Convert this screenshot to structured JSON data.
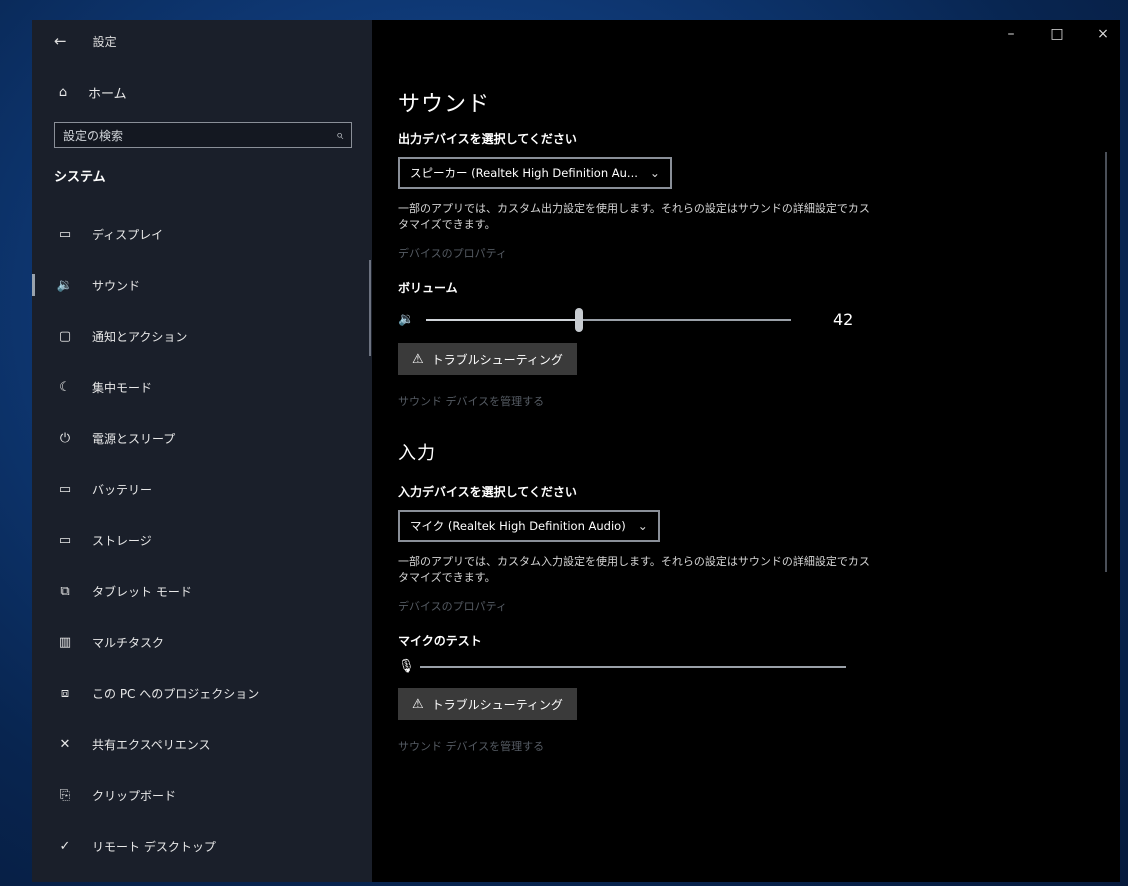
{
  "window": {
    "title": "設定",
    "minimize": "–",
    "maximize": "□",
    "close": "×"
  },
  "sidebar": {
    "back_icon": "←",
    "home_label": "ホーム",
    "search_placeholder": "設定の検索",
    "section": "システム",
    "items": [
      {
        "label": "ディスプレイ",
        "icon": "▭",
        "active": false
      },
      {
        "label": "サウンド",
        "icon": "🔉",
        "active": true
      },
      {
        "label": "通知とアクション",
        "icon": "▢",
        "active": false
      },
      {
        "label": "集中モード",
        "icon": "☾",
        "active": false
      },
      {
        "label": "電源とスリープ",
        "icon": "⏻",
        "active": false
      },
      {
        "label": "バッテリー",
        "icon": "▭",
        "active": false
      },
      {
        "label": "ストレージ",
        "icon": "▭",
        "active": false
      },
      {
        "label": "タブレット モード",
        "icon": "⧉",
        "active": false
      },
      {
        "label": "マルチタスク",
        "icon": "▥",
        "active": false
      },
      {
        "label": "この PC へのプロジェクション",
        "icon": "⧈",
        "active": false
      },
      {
        "label": "共有エクスペリエンス",
        "icon": "✕",
        "active": false
      },
      {
        "label": "クリップボード",
        "icon": "⎘",
        "active": false
      },
      {
        "label": "リモート デスクトップ",
        "icon": "✓",
        "active": false
      }
    ]
  },
  "main": {
    "title": "サウンド",
    "output": {
      "label": "出力デバイスを選択してください",
      "device": "スピーカー (Realtek High Definition Au...",
      "desc": "一部のアプリでは、カスタム出力設定を使用します。それらの設定はサウンドの詳細設定でカスタマイズできます。",
      "properties_link": "デバイスのプロパティ",
      "volume_label": "ボリューム",
      "volume": 42,
      "volume_text": "42",
      "troubleshoot": "トラブルシューティング",
      "manage_link": "サウンド デバイスを管理する"
    },
    "input": {
      "heading": "入力",
      "label": "入力デバイスを選択してください",
      "device": "マイク (Realtek High Definition Audio)",
      "desc": "一部のアプリでは、カスタム入力設定を使用します。それらの設定はサウンドの詳細設定でカスタマイズできます。",
      "properties_link": "デバイスのプロパティ",
      "test_label": "マイクのテスト",
      "troubleshoot": "トラブルシューティング",
      "manage_link": "サウンド デバイスを管理する"
    }
  }
}
